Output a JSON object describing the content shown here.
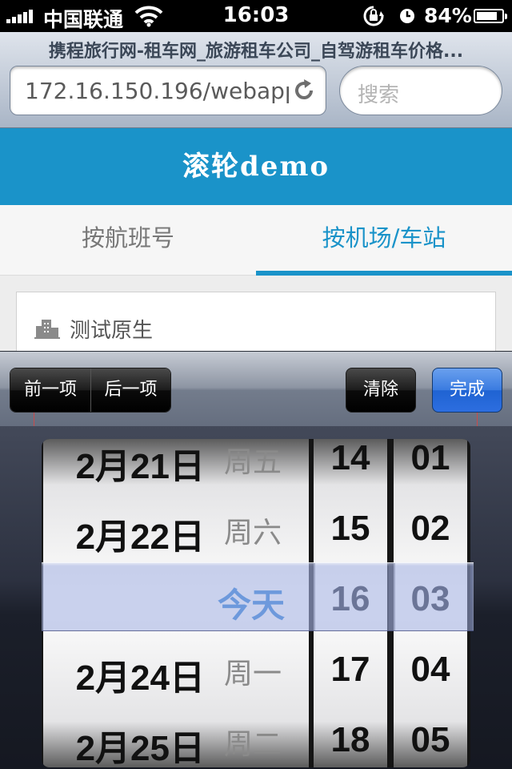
{
  "status_bar": {
    "carrier": "中国联通",
    "time": "16:03",
    "battery_percent": "84%",
    "battery_level": 0.84
  },
  "browser": {
    "page_title": "携程旅行网-租车网_旅游租车公司_自驾游租车价格...",
    "url": "172.16.150.196/webapp",
    "search_placeholder": "搜索"
  },
  "app": {
    "header_title": "滚轮demo",
    "tabs": [
      {
        "label": "按航班号",
        "active": false
      },
      {
        "label": "按机场/车站",
        "active": true
      }
    ],
    "field_label": "测试原生"
  },
  "accessory_bar": {
    "prev_label": "前一项",
    "next_label": "后一项",
    "clear_label": "清除",
    "done_label": "完成"
  },
  "picker": {
    "dates": [
      {
        "date": "2月21日",
        "weekday": "周五"
      },
      {
        "date": "2月22日",
        "weekday": "周六"
      },
      {
        "date": "今天",
        "weekday": ""
      },
      {
        "date": "2月24日",
        "weekday": "周一"
      },
      {
        "date": "2月25日",
        "weekday": "周二"
      }
    ],
    "hours": [
      "14",
      "15",
      "16",
      "17",
      "18"
    ],
    "minutes": [
      "01",
      "02",
      "03",
      "04",
      "05"
    ],
    "selected": {
      "date": "今天",
      "hour": "16",
      "minute": "03"
    }
  },
  "colors": {
    "header_bg": "#1a93c9",
    "active_tab": "#1a93c9",
    "done_button": "#2d6ee0",
    "today_text": "#2f7fd6"
  }
}
